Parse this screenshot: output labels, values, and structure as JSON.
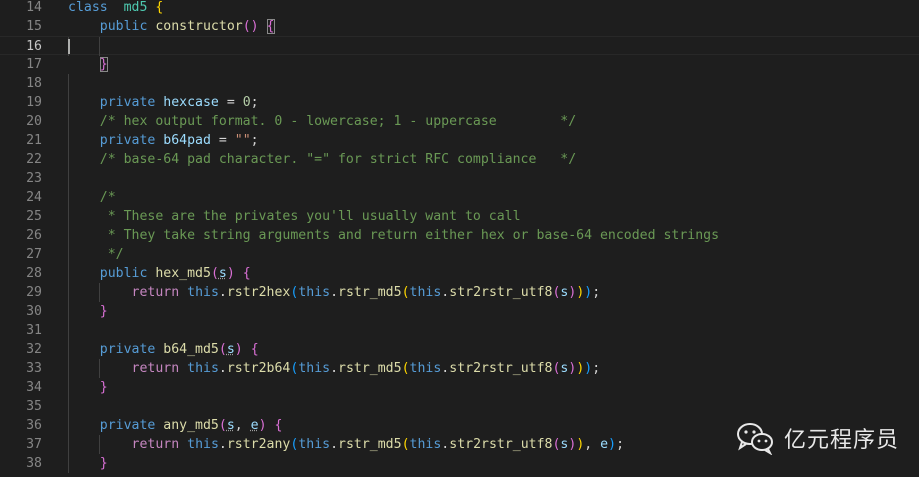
{
  "editor": {
    "active_line": 16,
    "lines": [
      {
        "n": "14",
        "tokens": [
          [
            "kw",
            "class"
          ],
          [
            "",
            "  "
          ],
          [
            "cls",
            "md5"
          ],
          [
            "",
            ""
          ],
          [
            "b1",
            " {"
          ]
        ]
      },
      {
        "n": "15",
        "tokens": [
          [
            "",
            "    "
          ],
          [
            "kw",
            "public"
          ],
          [
            "",
            " "
          ],
          [
            "fn",
            "constructor"
          ],
          [
            "b2",
            "()"
          ],
          [
            "",
            " "
          ],
          [
            "b2m",
            "{"
          ]
        ]
      },
      {
        "n": "16",
        "tokens": []
      },
      {
        "n": "17",
        "tokens": [
          [
            "",
            "    "
          ],
          [
            "b2m",
            "}"
          ]
        ]
      },
      {
        "n": "18",
        "tokens": []
      },
      {
        "n": "19",
        "tokens": [
          [
            "",
            "    "
          ],
          [
            "kw",
            "private"
          ],
          [
            "",
            " "
          ],
          [
            "var",
            "hexcase"
          ],
          [
            "",
            " = "
          ],
          [
            "num",
            "0"
          ],
          [
            "",
            ";"
          ]
        ]
      },
      {
        "n": "20",
        "tokens": [
          [
            "",
            "    "
          ],
          [
            "cm",
            "/* hex output format. 0 - lowercase; 1 - uppercase        */"
          ]
        ]
      },
      {
        "n": "21",
        "tokens": [
          [
            "",
            "    "
          ],
          [
            "kw",
            "private"
          ],
          [
            "",
            " "
          ],
          [
            "var",
            "b64pad"
          ],
          [
            "",
            " = "
          ],
          [
            "str",
            "\"\""
          ],
          [
            "",
            ";"
          ]
        ]
      },
      {
        "n": "22",
        "tokens": [
          [
            "",
            "    "
          ],
          [
            "cm",
            "/* base-64 pad character. \"=\" for strict RFC compliance   */"
          ]
        ]
      },
      {
        "n": "23",
        "tokens": []
      },
      {
        "n": "24",
        "tokens": [
          [
            "",
            "    "
          ],
          [
            "cm",
            "/*"
          ]
        ]
      },
      {
        "n": "25",
        "tokens": [
          [
            "",
            "    "
          ],
          [
            "cm",
            " * These are the privates you'll usually want to call"
          ]
        ]
      },
      {
        "n": "26",
        "tokens": [
          [
            "",
            "    "
          ],
          [
            "cm",
            " * They take string arguments and return either hex or base-64 encoded strings"
          ]
        ]
      },
      {
        "n": "27",
        "tokens": [
          [
            "",
            "    "
          ],
          [
            "cm",
            " */"
          ]
        ]
      },
      {
        "n": "28",
        "tokens": [
          [
            "",
            "    "
          ],
          [
            "kw",
            "public"
          ],
          [
            "",
            " "
          ],
          [
            "fn",
            "hex_md5"
          ],
          [
            "b2",
            "("
          ],
          [
            "varsq",
            "s"
          ],
          [
            "b2",
            ")"
          ],
          [
            "",
            " "
          ],
          [
            "b2",
            "{"
          ]
        ]
      },
      {
        "n": "29",
        "tokens": [
          [
            "",
            "        "
          ],
          [
            "ctl",
            "return"
          ],
          [
            "",
            " "
          ],
          [
            "kw",
            "this"
          ],
          [
            "",
            "."
          ],
          [
            "fn",
            "rstr2hex"
          ],
          [
            "b3",
            "("
          ],
          [
            "kw",
            "this"
          ],
          [
            "",
            "."
          ],
          [
            "fn",
            "rstr_md5"
          ],
          [
            "b1",
            "("
          ],
          [
            "kw",
            "this"
          ],
          [
            "",
            "."
          ],
          [
            "fn",
            "str2rstr_utf8"
          ],
          [
            "b2",
            "("
          ],
          [
            "var",
            "s"
          ],
          [
            "b2",
            ")"
          ],
          [
            "b1",
            ")"
          ],
          [
            "b3",
            ")"
          ],
          [
            "",
            ";"
          ]
        ]
      },
      {
        "n": "30",
        "tokens": [
          [
            "",
            "    "
          ],
          [
            "b2",
            "}"
          ]
        ]
      },
      {
        "n": "31",
        "tokens": []
      },
      {
        "n": "32",
        "tokens": [
          [
            "",
            "    "
          ],
          [
            "kw",
            "private"
          ],
          [
            "",
            " "
          ],
          [
            "fn",
            "b64_md5"
          ],
          [
            "b2",
            "("
          ],
          [
            "varsq",
            "s"
          ],
          [
            "b2",
            ")"
          ],
          [
            "",
            " "
          ],
          [
            "b2",
            "{"
          ]
        ]
      },
      {
        "n": "33",
        "tokens": [
          [
            "",
            "        "
          ],
          [
            "ctl",
            "return"
          ],
          [
            "",
            " "
          ],
          [
            "kw",
            "this"
          ],
          [
            "",
            "."
          ],
          [
            "fn",
            "rstr2b64"
          ],
          [
            "b3",
            "("
          ],
          [
            "kw",
            "this"
          ],
          [
            "",
            "."
          ],
          [
            "fn",
            "rstr_md5"
          ],
          [
            "b1",
            "("
          ],
          [
            "kw",
            "this"
          ],
          [
            "",
            "."
          ],
          [
            "fn",
            "str2rstr_utf8"
          ],
          [
            "b2",
            "("
          ],
          [
            "var",
            "s"
          ],
          [
            "b2",
            ")"
          ],
          [
            "b1",
            ")"
          ],
          [
            "b3",
            ")"
          ],
          [
            "",
            ";"
          ]
        ]
      },
      {
        "n": "34",
        "tokens": [
          [
            "",
            "    "
          ],
          [
            "b2",
            "}"
          ]
        ]
      },
      {
        "n": "35",
        "tokens": []
      },
      {
        "n": "36",
        "tokens": [
          [
            "",
            "    "
          ],
          [
            "kw",
            "private"
          ],
          [
            "",
            " "
          ],
          [
            "fn",
            "any_md5"
          ],
          [
            "b2",
            "("
          ],
          [
            "varsq",
            "s"
          ],
          [
            "",
            ", "
          ],
          [
            "varsq",
            "e"
          ],
          [
            "b2",
            ")"
          ],
          [
            "",
            " "
          ],
          [
            "b2",
            "{"
          ]
        ]
      },
      {
        "n": "37",
        "tokens": [
          [
            "",
            "        "
          ],
          [
            "ctl",
            "return"
          ],
          [
            "",
            " "
          ],
          [
            "kw",
            "this"
          ],
          [
            "",
            "."
          ],
          [
            "fn",
            "rstr2any"
          ],
          [
            "b3",
            "("
          ],
          [
            "kw",
            "this"
          ],
          [
            "",
            "."
          ],
          [
            "fn",
            "rstr_md5"
          ],
          [
            "b1",
            "("
          ],
          [
            "kw",
            "this"
          ],
          [
            "",
            "."
          ],
          [
            "fn",
            "str2rstr_utf8"
          ],
          [
            "b2",
            "("
          ],
          [
            "var",
            "s"
          ],
          [
            "b2",
            ")"
          ],
          [
            "b1",
            ")"
          ],
          [
            "",
            ", "
          ],
          [
            "var",
            "e"
          ],
          [
            "b3",
            ")"
          ],
          [
            "",
            ";"
          ]
        ]
      },
      {
        "n": "38",
        "tokens": [
          [
            "",
            "    "
          ],
          [
            "b2",
            "}"
          ]
        ]
      }
    ]
  },
  "watermark": {
    "text": "亿元程序员",
    "icon": "wechat-icon"
  }
}
